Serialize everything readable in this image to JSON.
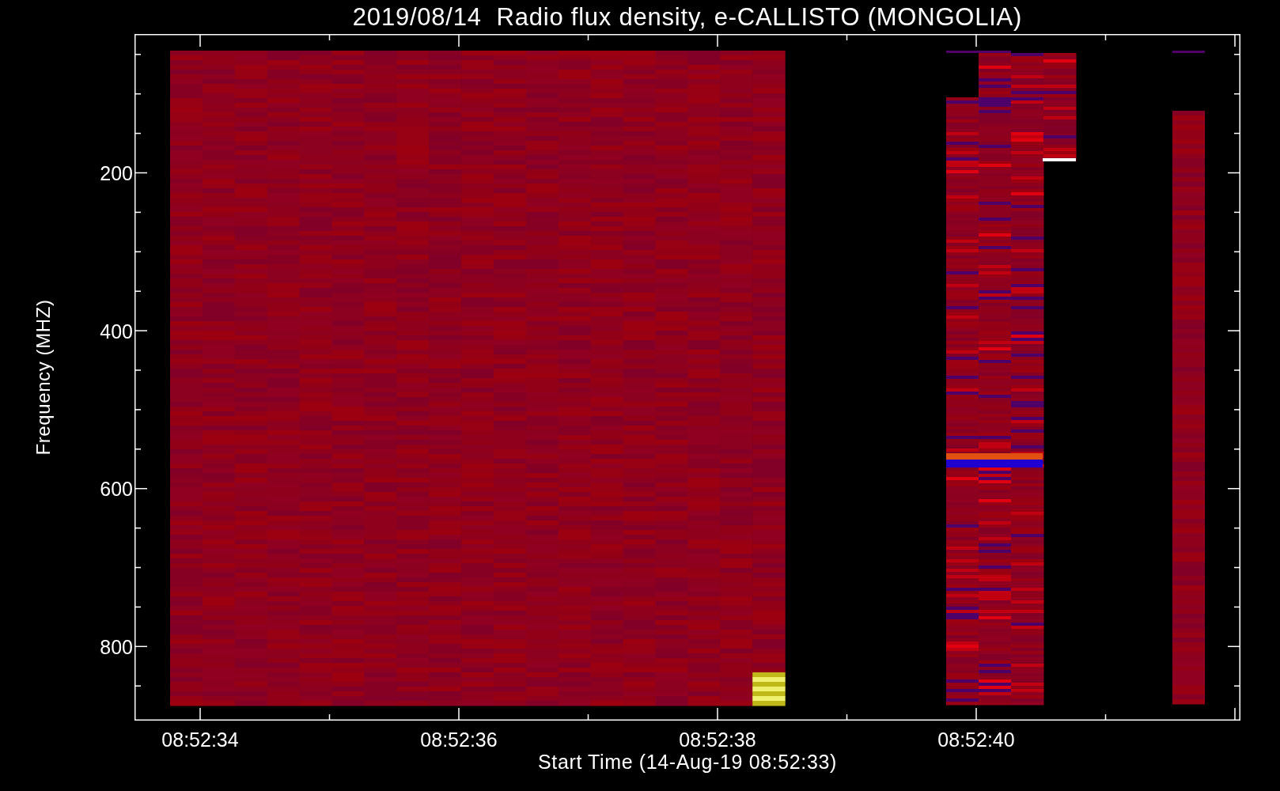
{
  "title": "2019/08/14  Radio flux density, e-CALLISTO (MONGOLIA)",
  "plot": {
    "ylabel": "Frequency (MHZ)",
    "yticks": [
      "200",
      "400",
      "600",
      "800"
    ],
    "xticks": [
      "08:52:34",
      "08:52:36",
      "08:52:38",
      "08:52:40"
    ],
    "xlabel": "Start Time (14-Aug-19 08:52:33)"
  }
}
